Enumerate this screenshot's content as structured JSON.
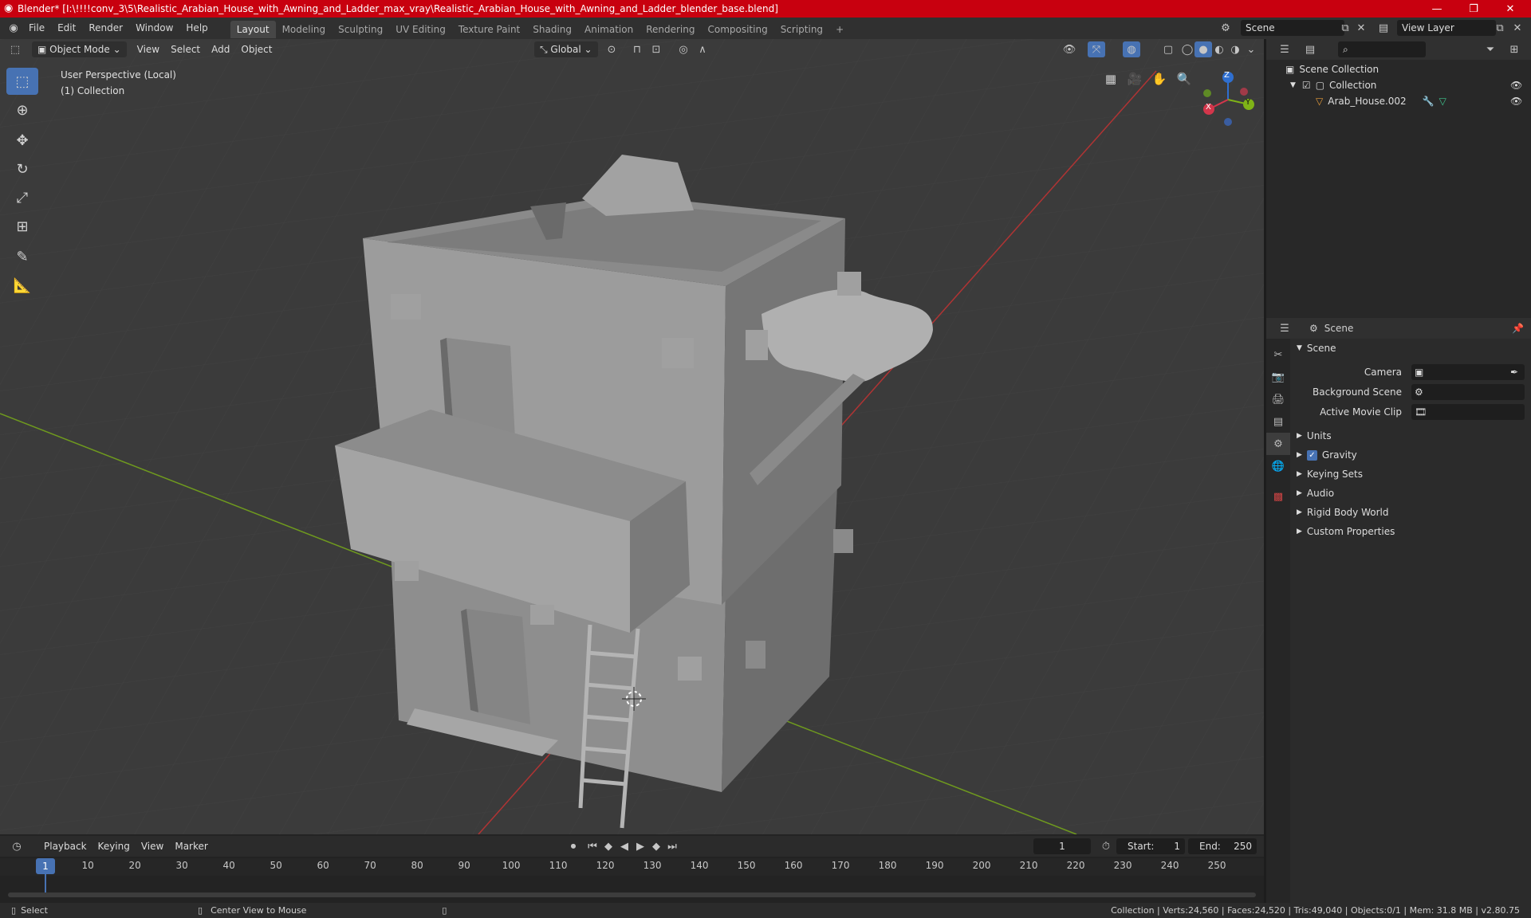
{
  "window": {
    "title": "Blender* [I:\\!!!!conv_3\\5\\Realistic_Arabian_House_with_Awning_and_Ladder_max_vray\\Realistic_Arabian_House_with_Awning_and_Ladder_blender_base.blend]",
    "minimize": "—",
    "maximize": "❐",
    "close": "✕"
  },
  "menu": [
    "File",
    "Edit",
    "Render",
    "Window",
    "Help"
  ],
  "workspaces": [
    "Layout",
    "Modeling",
    "Sculpting",
    "UV Editing",
    "Texture Paint",
    "Shading",
    "Animation",
    "Rendering",
    "Compositing",
    "Scripting"
  ],
  "active_workspace": "Layout",
  "add_workspace": "+",
  "scene_selector": "Scene",
  "view_layer": "View Layer",
  "viewport_header": {
    "mode": "Object Mode",
    "menus": [
      "View",
      "Select",
      "Add",
      "Object"
    ],
    "transform_orientation": "Global"
  },
  "viewport_info": {
    "perspective": "User Perspective (Local)",
    "collection": "(1) Collection"
  },
  "gizmo": {
    "x": "X",
    "y": "Y",
    "z": "Z"
  },
  "outliner": {
    "root": "Scene Collection",
    "collection": "Collection",
    "object": "Arab_House.002"
  },
  "properties": {
    "header": "Scene",
    "section": "Scene",
    "camera_label": "Camera",
    "background_label": "Background Scene",
    "movie_clip_label": "Active Movie Clip",
    "panels": [
      "Units",
      "Gravity",
      "Keying Sets",
      "Audio",
      "Rigid Body World",
      "Custom Properties"
    ]
  },
  "timeline": {
    "menus": [
      "Playback",
      "Keying",
      "View",
      "Marker"
    ],
    "current_frame": "1",
    "start_label": "Start:",
    "start": "1",
    "end_label": "End:",
    "end": "250",
    "ticks": [
      "1",
      "10",
      "20",
      "30",
      "40",
      "50",
      "60",
      "70",
      "80",
      "90",
      "100",
      "110",
      "120",
      "130",
      "140",
      "150",
      "160",
      "170",
      "180",
      "190",
      "200",
      "210",
      "220",
      "230",
      "240",
      "250"
    ]
  },
  "status": {
    "left": "Select",
    "middle": "Center View to Mouse",
    "right": "Collection | Verts:24,560 | Faces:24,520 | Tris:49,040 | Objects:0/1 | Mem: 31.8 MB | v2.80.75"
  },
  "colors": {
    "title_bar": "#c8000f",
    "accent": "#4772b3",
    "viewport_bg": "#3b3b3b",
    "axis_x": "#b03434",
    "axis_y": "#6f9a1e",
    "model": "#9a9a9a"
  }
}
